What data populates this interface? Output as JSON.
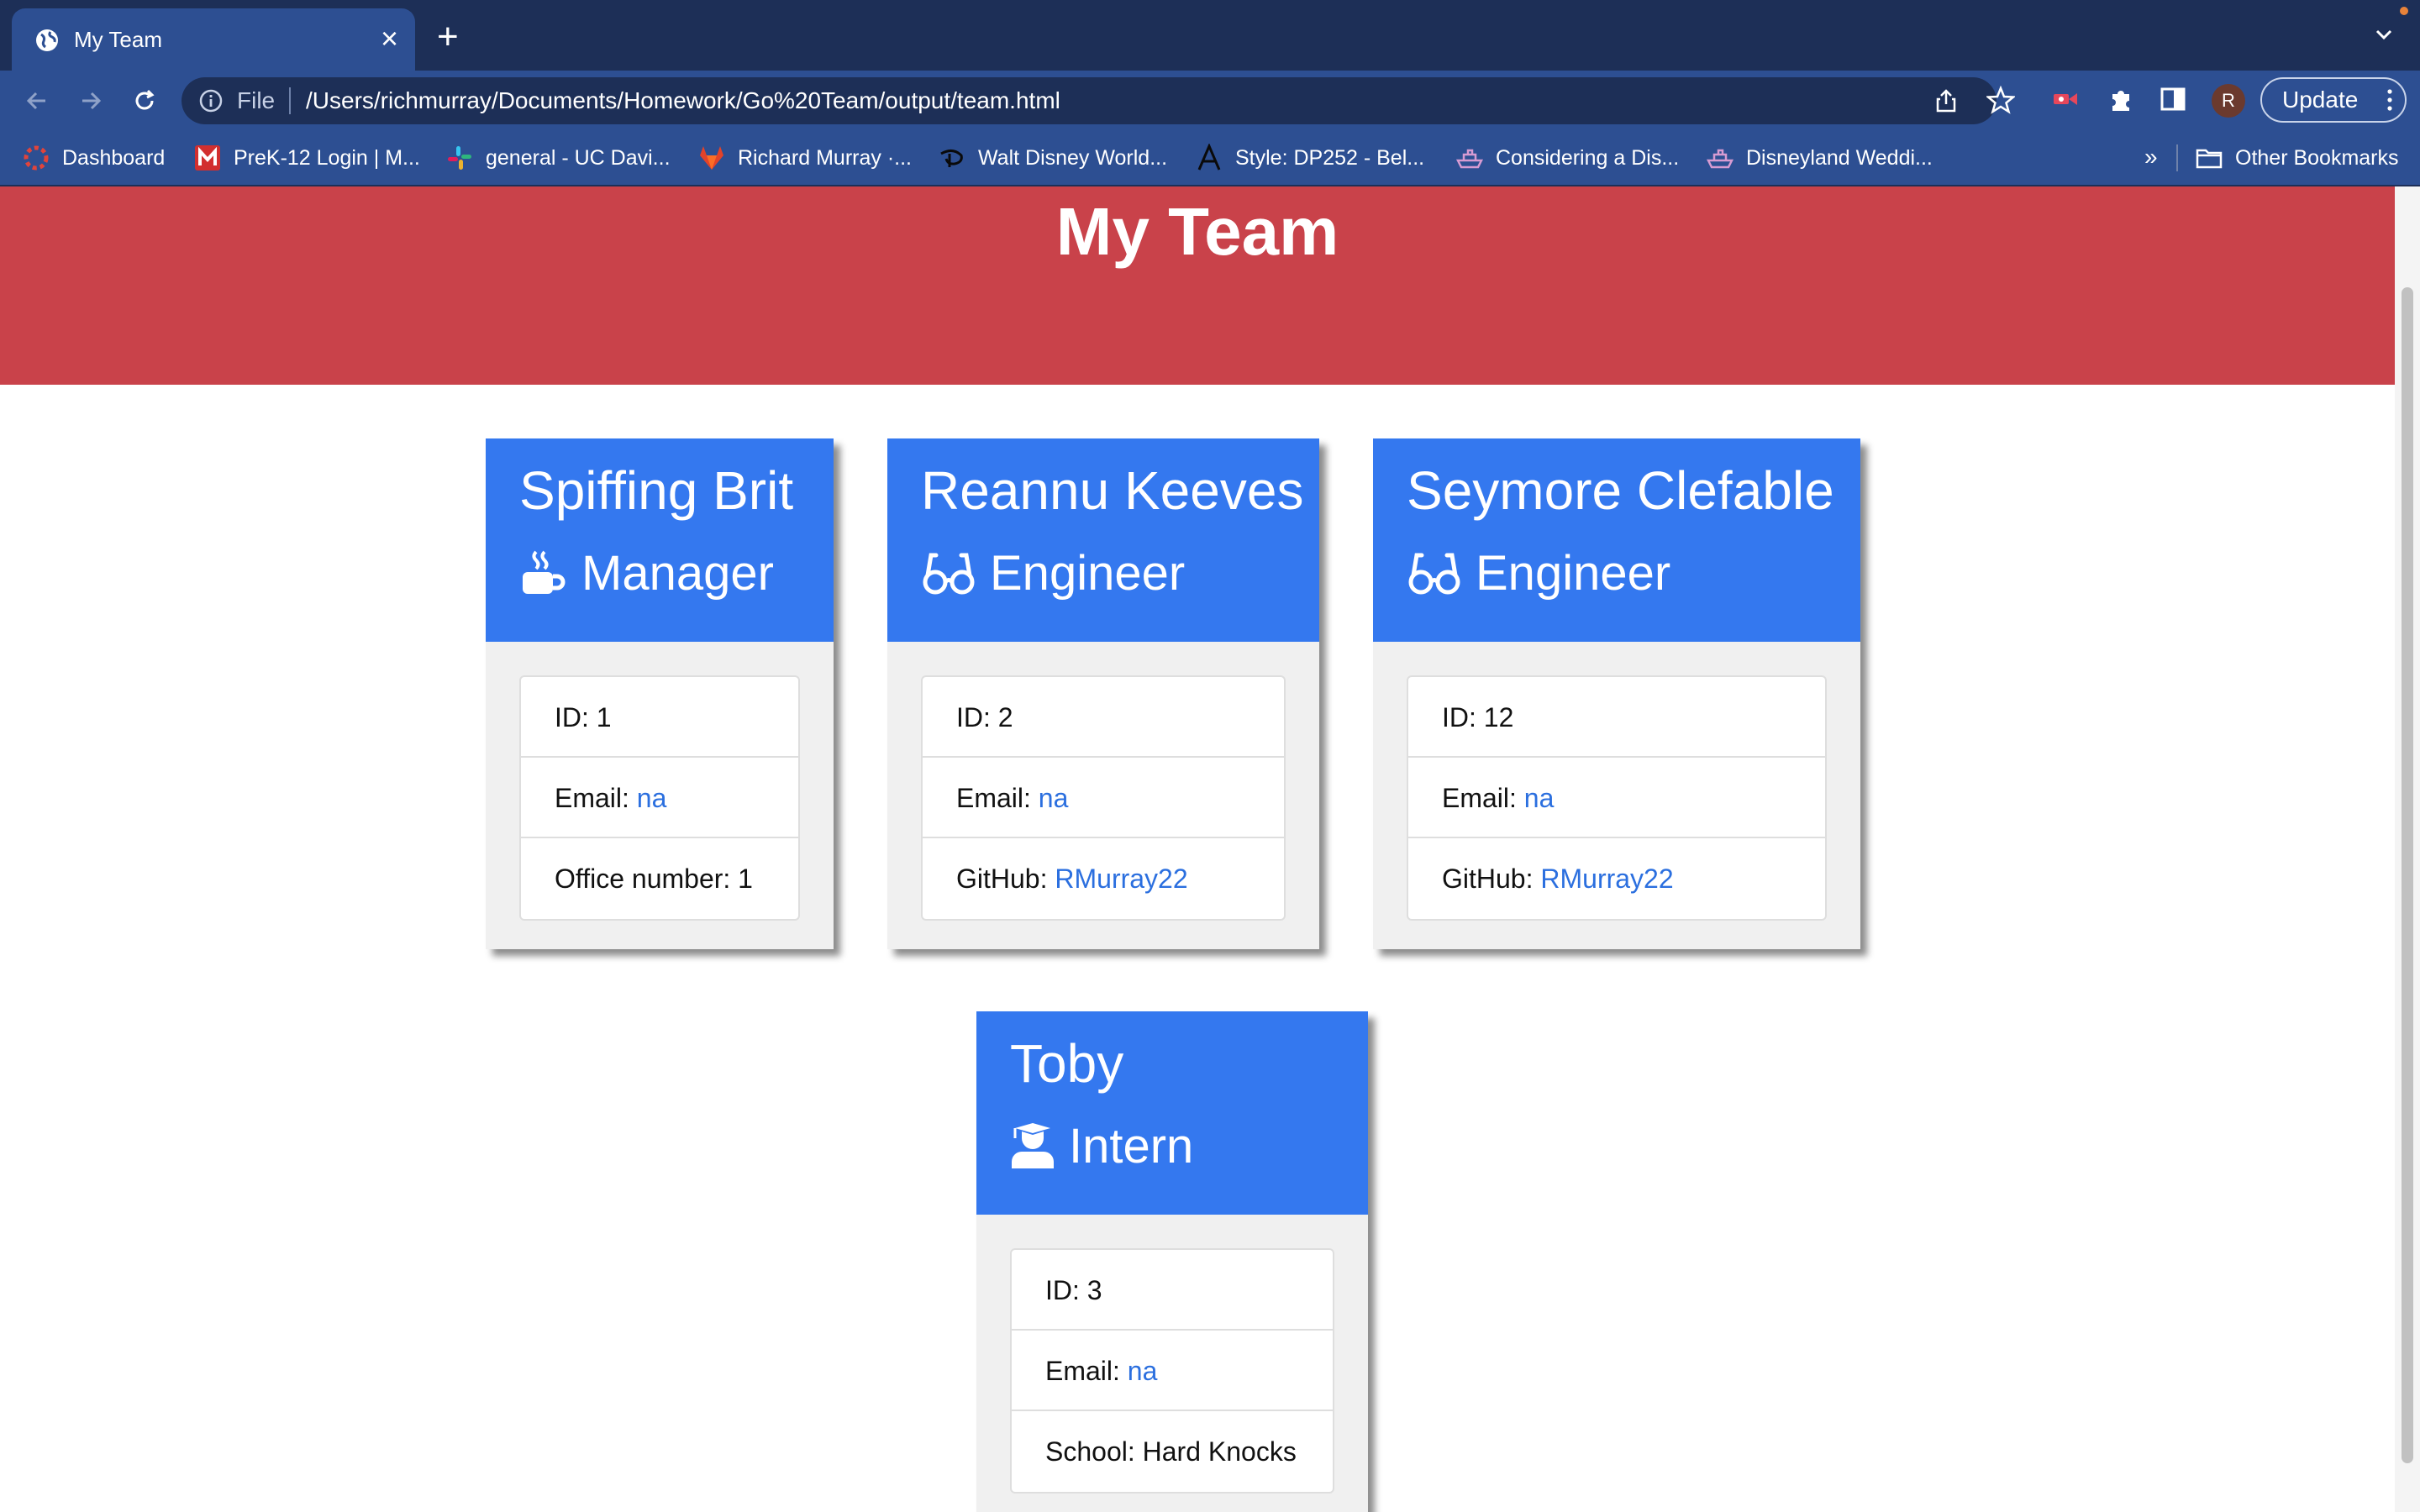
{
  "browser": {
    "tab": {
      "title": "My Team"
    },
    "address_bar": {
      "scheme_label": "File",
      "url": "/Users/richmurray/Documents/Homework/Go%20Team/output/team.html"
    },
    "profile_initial": "R",
    "update_label": "Update",
    "bookmarks": [
      {
        "label": "Dashboard",
        "icon": "canvas-icon"
      },
      {
        "label": "PreK-12 Login | M...",
        "icon": "m-logo-icon"
      },
      {
        "label": "general - UC Davi...",
        "icon": "slack-icon"
      },
      {
        "label": "Richard Murray ·...",
        "icon": "gitlab-icon"
      },
      {
        "label": "Walt Disney World...",
        "icon": "disney-icon"
      },
      {
        "label": "Style: DP252 - Bel...",
        "icon": "font-a-icon"
      },
      {
        "label": "Considering a Dis...",
        "icon": "cruise-ship-icon"
      },
      {
        "label": "Disneyland Weddi...",
        "icon": "cruise-ship-icon"
      }
    ],
    "bookmarks_overflow": "»",
    "other_bookmarks": "Other Bookmarks"
  },
  "page": {
    "title": "My Team",
    "colors": {
      "header": "#c9424a",
      "card_header": "#3478ef",
      "link": "#2b6fdf"
    },
    "cards": [
      {
        "name": "Spiffing Brit",
        "role": "Manager",
        "role_icon": "coffee-mug-icon",
        "id_label": "ID: 1",
        "email_label": "Email: ",
        "email": "na",
        "extra_label": "Office number: 1",
        "extra_link": ""
      },
      {
        "name": "Reannu Keeves",
        "role": "Engineer",
        "role_icon": "glasses-icon",
        "id_label": "ID: 2",
        "email_label": "Email: ",
        "email": "na",
        "extra_label": "GitHub: ",
        "extra_link": "RMurray22"
      },
      {
        "name": "Seymore Clefable",
        "role": "Engineer",
        "role_icon": "glasses-icon",
        "id_label": "ID: 12",
        "email_label": "Email: ",
        "email": "na",
        "extra_label": "GitHub: ",
        "extra_link": "RMurray22"
      },
      {
        "name": "Toby",
        "role": "Intern",
        "role_icon": "graduate-icon",
        "id_label": "ID: 3",
        "email_label": "Email: ",
        "email": "na",
        "extra_label": "School: Hard Knocks",
        "extra_link": ""
      }
    ]
  }
}
